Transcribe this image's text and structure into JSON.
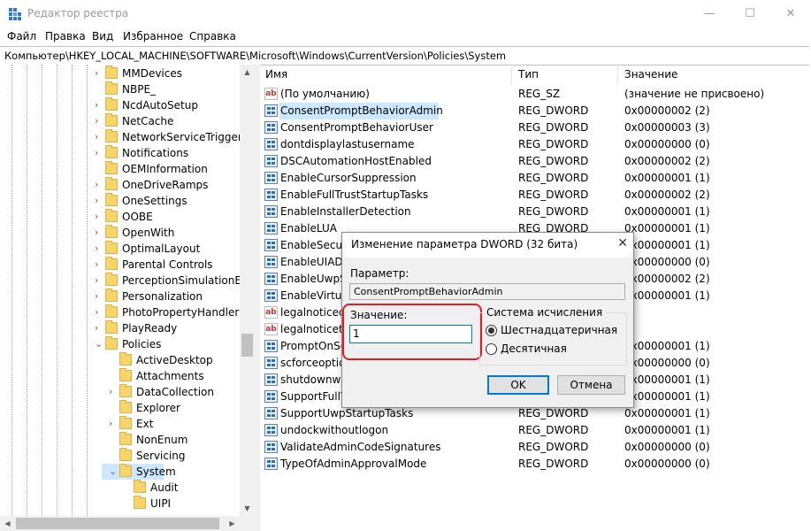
{
  "window": {
    "title": "Редактор реестра",
    "minimize": "—",
    "maximize": "☐",
    "close": "✕"
  },
  "menu": [
    "Файл",
    "Правка",
    "Вид",
    "Избранное",
    "Справка"
  ],
  "address": "Компьютер\\HKEY_LOCAL_MACHINE\\SOFTWARE\\Microsoft\\Windows\\CurrentVersion\\Policies\\System",
  "tree": {
    "items": [
      {
        "label": "MMDevices",
        "expander": true,
        "level": 0
      },
      {
        "label": "NBPE_",
        "expander": false,
        "level": 0
      },
      {
        "label": "NcdAutoSetup",
        "expander": true,
        "level": 0
      },
      {
        "label": "NetCache",
        "expander": true,
        "level": 0
      },
      {
        "label": "NetworkServiceTriggers",
        "expander": true,
        "level": 0
      },
      {
        "label": "Notifications",
        "expander": true,
        "level": 0
      },
      {
        "label": "OEMInformation",
        "expander": false,
        "level": 0
      },
      {
        "label": "OneDriveRamps",
        "expander": true,
        "level": 0
      },
      {
        "label": "OneSettings",
        "expander": true,
        "level": 0
      },
      {
        "label": "OOBE",
        "expander": true,
        "level": 0
      },
      {
        "label": "OpenWith",
        "expander": true,
        "level": 0
      },
      {
        "label": "OptimalLayout",
        "expander": true,
        "level": 0
      },
      {
        "label": "Parental Controls",
        "expander": true,
        "level": 0
      },
      {
        "label": "PerceptionSimulationExt",
        "expander": true,
        "level": 0
      },
      {
        "label": "Personalization",
        "expander": true,
        "level": 0
      },
      {
        "label": "PhotoPropertyHandler",
        "expander": true,
        "level": 0
      },
      {
        "label": "PlayReady",
        "expander": true,
        "level": 0
      },
      {
        "label": "Policies",
        "expander": "open",
        "level": 0
      },
      {
        "label": "ActiveDesktop",
        "expander": false,
        "level": 1
      },
      {
        "label": "Attachments",
        "expander": false,
        "level": 1
      },
      {
        "label": "DataCollection",
        "expander": true,
        "level": 1
      },
      {
        "label": "Explorer",
        "expander": false,
        "level": 1
      },
      {
        "label": "Ext",
        "expander": true,
        "level": 1
      },
      {
        "label": "NonEnum",
        "expander": false,
        "level": 1
      },
      {
        "label": "Servicing",
        "expander": false,
        "level": 1
      },
      {
        "label": "System",
        "expander": "open",
        "level": 1,
        "selected": true
      },
      {
        "label": "Audit",
        "expander": false,
        "level": 2
      },
      {
        "label": "UIPI",
        "expander": false,
        "level": 2
      }
    ]
  },
  "list": {
    "columns": [
      "Имя",
      "Тип",
      "Значение"
    ],
    "rows": [
      {
        "icon": "string",
        "name": "(По умолчанию)",
        "type": "REG_SZ",
        "value": "(значение не присвоено)"
      },
      {
        "icon": "binary",
        "name": "ConsentPromptBehaviorAdmin",
        "type": "REG_DWORD",
        "value": "0x00000002 (2)",
        "selected": true
      },
      {
        "icon": "binary",
        "name": "ConsentPromptBehaviorUser",
        "type": "REG_DWORD",
        "value": "0x00000003 (3)"
      },
      {
        "icon": "binary",
        "name": "dontdisplaylastusername",
        "type": "REG_DWORD",
        "value": "0x00000000 (0)"
      },
      {
        "icon": "binary",
        "name": "DSCAutomationHostEnabled",
        "type": "REG_DWORD",
        "value": "0x00000002 (2)"
      },
      {
        "icon": "binary",
        "name": "EnableCursorSuppression",
        "type": "REG_DWORD",
        "value": "0x00000001 (1)"
      },
      {
        "icon": "binary",
        "name": "EnableFullTrustStartupTasks",
        "type": "REG_DWORD",
        "value": "0x00000002 (2)"
      },
      {
        "icon": "binary",
        "name": "EnableInstallerDetection",
        "type": "REG_DWORD",
        "value": "0x00000001 (1)"
      },
      {
        "icon": "binary",
        "name": "EnableLUA",
        "type": "REG_DWORD",
        "value": "0x00000001 (1)"
      },
      {
        "icon": "binary",
        "name": "EnableSecure",
        "type": "",
        "value": "0x00000001 (1)"
      },
      {
        "icon": "binary",
        "name": "EnableUIADe",
        "type": "",
        "value": "0x00000000 (0)"
      },
      {
        "icon": "binary",
        "name": "EnableUwpSt",
        "type": "",
        "value": "0x00000002 (2)"
      },
      {
        "icon": "binary",
        "name": "EnableVirtual",
        "type": "",
        "value": "0x00000001 (1)"
      },
      {
        "icon": "string",
        "name": "legalnoticeca",
        "type": "",
        "value": ""
      },
      {
        "icon": "string",
        "name": "legalnoticete",
        "type": "",
        "value": ""
      },
      {
        "icon": "binary",
        "name": "PromptOnSe",
        "type": "",
        "value": "0x00000001 (1)"
      },
      {
        "icon": "binary",
        "name": "scforceoption",
        "type": "",
        "value": "0x00000000 (0)"
      },
      {
        "icon": "binary",
        "name": "shutdownwit",
        "type": "",
        "value": "0x00000001 (1)"
      },
      {
        "icon": "binary",
        "name": "SupportFullTr",
        "type": "",
        "value": "0x00000001 (1)"
      },
      {
        "icon": "binary",
        "name": "SupportUwpStartupTasks",
        "type": "REG_DWORD",
        "value": "0x00000001 (1)"
      },
      {
        "icon": "binary",
        "name": "undockwithoutlogon",
        "type": "REG_DWORD",
        "value": "0x00000001 (1)"
      },
      {
        "icon": "binary",
        "name": "ValidateAdminCodeSignatures",
        "type": "REG_DWORD",
        "value": "0x00000000 (0)"
      },
      {
        "icon": "binary",
        "name": "TypeOfAdminApprovalMode",
        "type": "REG_DWORD",
        "value": "0x00000000 (0)"
      }
    ]
  },
  "dialog": {
    "title": "Изменение параметра DWORD (32 бита)",
    "close": "✕",
    "param_label": "Параметр:",
    "param_value": "ConsentPromptBehaviorAdmin",
    "value_label": "Значение:",
    "value": "1",
    "radix_group": "Система исчисления",
    "radix_hex": "Шестнадцатеричная",
    "radix_dec": "Десятичная",
    "radix_selected": "hex",
    "ok": "OK",
    "cancel": "Отмена",
    "highlight_color": "#e02020"
  }
}
